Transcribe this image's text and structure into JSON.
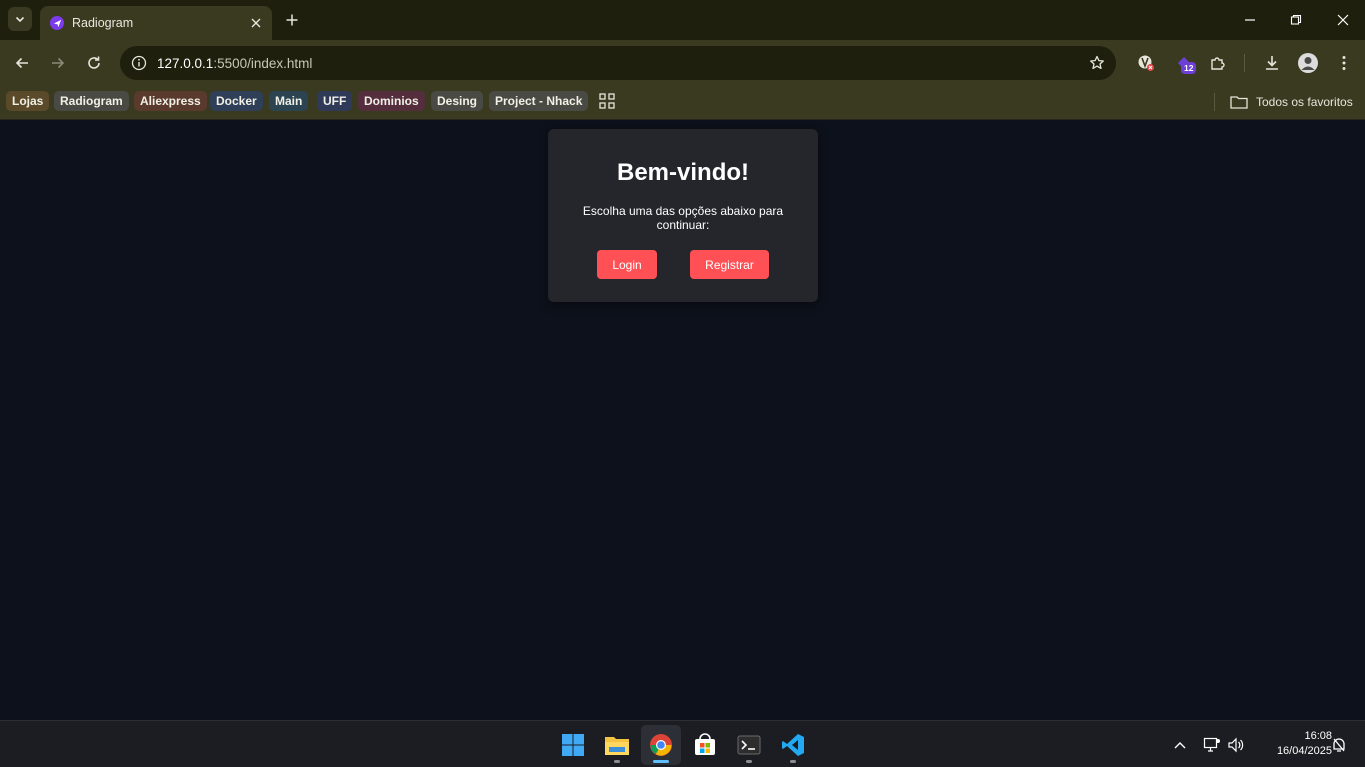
{
  "browser": {
    "tab_title": "Radiogram",
    "url_host": "127.0.0.1",
    "url_rest": ":5500/index.html",
    "extension_badge": "12",
    "bookmarks": [
      {
        "label": "Lojas",
        "color": "#5a4a2a"
      },
      {
        "label": "Radiogram",
        "color": "#4a4a44"
      },
      {
        "label": "Aliexpress",
        "color": "#5a3a2c"
      },
      {
        "label": "Docker",
        "color": "#2f3f58"
      },
      {
        "label": "Main",
        "color": "#2c4452"
      },
      {
        "label": "UFF",
        "color": "#2f3a58"
      },
      {
        "label": "Dominios",
        "color": "#552e3e"
      },
      {
        "label": "Desing",
        "color": "#4a4a44"
      },
      {
        "label": "Project - Nhack",
        "color": "#4a4a44"
      }
    ],
    "all_bookmarks_label": "Todos os favoritos"
  },
  "page": {
    "title": "Bem-vindo!",
    "subtitle": "Escolha uma das opções abaixo para continuar:",
    "login_label": "Login",
    "register_label": "Registrar",
    "accent_color": "#ff5055"
  },
  "taskbar": {
    "apps": [
      "windows-start",
      "file-explorer",
      "chrome",
      "microsoft-store",
      "terminal",
      "vscode"
    ],
    "time": "16:08",
    "date": "16/04/2025"
  }
}
